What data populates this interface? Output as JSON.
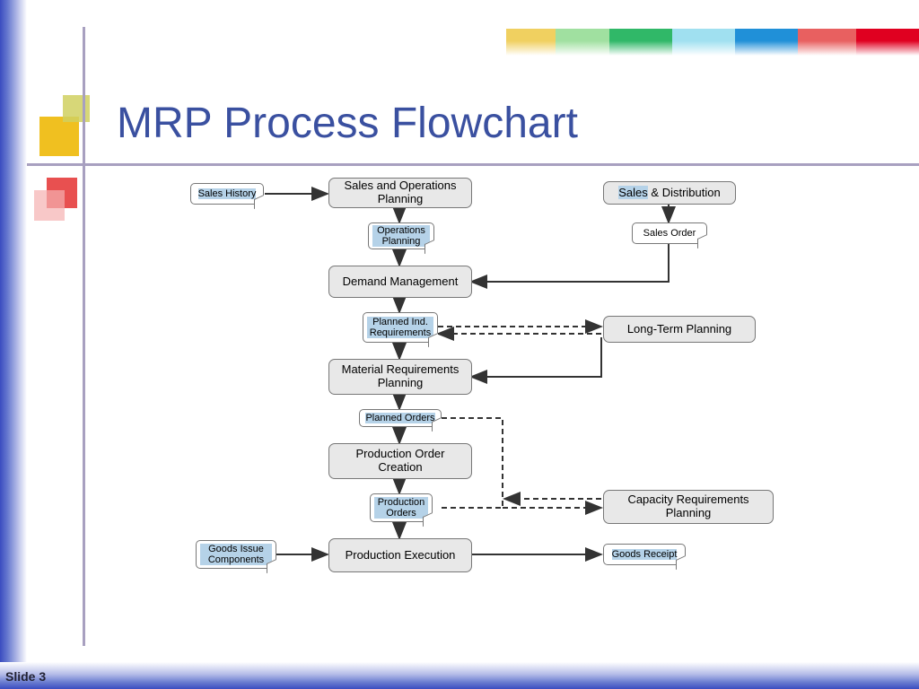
{
  "title": "MRP Process Flowchart",
  "slide_label": "Slide 3",
  "rainbow_colors": [
    "#f0d060",
    "#a0e0a0",
    "#30b868",
    "#a0e0f0",
    "#2090d8",
    "#e86060",
    "#e00020"
  ],
  "nodes": {
    "sales_history": "Sales History",
    "sop": "Sales and Operations Planning",
    "sd_prefix": "Sales",
    "sd_suffix": " & Distribution",
    "ops_planning": "Operations Planning",
    "sales_order": "Sales Order",
    "demand_mgmt": "Demand Management",
    "pir": "Planned Ind. Requirements",
    "ltp": "Long-Term Planning",
    "mrp": "Material Requirements Planning",
    "planned_orders": "Planned Orders",
    "po_creation": "Production Order Creation",
    "prod_orders": "Production Orders",
    "crp": "Capacity Requirements Planning",
    "goods_issue": "Goods Issue Components",
    "prod_exec": "Production Execution",
    "goods_receipt": "Goods Receipt"
  }
}
